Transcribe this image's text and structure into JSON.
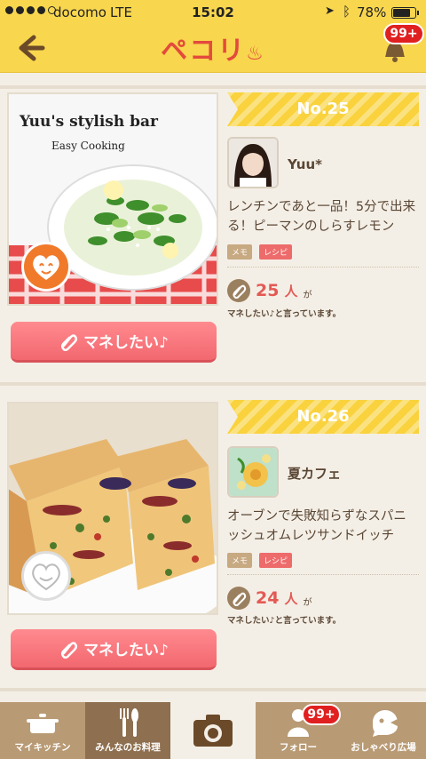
{
  "status": {
    "carrier": "docomo",
    "network": "LTE",
    "time": "15:02",
    "battery": "78%",
    "battery_level": 0.78
  },
  "header": {
    "logo": "ペコリ",
    "notifications": "99+",
    "icons": [
      "back-arrow-icon",
      "bell-icon"
    ]
  },
  "ranking": [
    {
      "rank": "No.25",
      "photo_title": "Yuu's stylish bar",
      "photo_subtitle": "Easy Cooking",
      "user": "Yuu*",
      "description": "レンチンであと一品！5分で出来る！ピーマンのしらすレモン",
      "tags": [
        "メモ",
        "レシピ"
      ],
      "count": "25",
      "count_unit": "人",
      "count_suffix": "が",
      "caption": "マネしたい♪と言っています。",
      "button": "マネしたい♪",
      "liked": true
    },
    {
      "rank": "No.26",
      "user": "夏カフェ",
      "description": "オーブンで失敗知らずなスパニッシュオムレツサンドイッチ",
      "tags": [
        "メモ",
        "レシピ"
      ],
      "count": "24",
      "count_unit": "人",
      "count_suffix": "が",
      "caption": "マネしたい♪と言っています。",
      "button": "マネしたい♪",
      "liked": false
    }
  ],
  "tabbar": {
    "items": [
      {
        "label": "マイキッチン",
        "icon": "pot-icon"
      },
      {
        "label": "みんなのお料理",
        "icon": "cutlery-icon"
      },
      {
        "label": "",
        "icon": "camera-icon"
      },
      {
        "label": "フォロー",
        "icon": "follow-icon",
        "badge": "99+"
      },
      {
        "label": "おしゃべり広場",
        "icon": "chat-icon"
      }
    ]
  },
  "colors": {
    "header": "#f8d64e",
    "accent": "#e34a3c",
    "button": "#f2686f",
    "tabbar": "#b89a74"
  }
}
